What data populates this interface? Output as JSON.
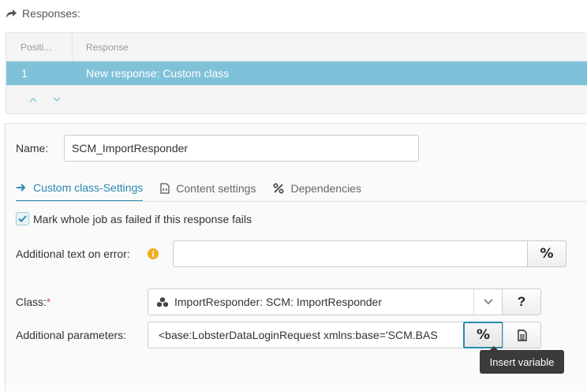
{
  "header": {
    "title": "Responses:",
    "icon": "share-arrow-icon"
  },
  "table": {
    "columns": [
      "Positi...",
      "Response"
    ],
    "rows": [
      {
        "position": "1",
        "response": "New response: Custom class",
        "selected": true
      }
    ],
    "controls": [
      "move-up-icon",
      "move-down-icon"
    ]
  },
  "form": {
    "name_label": "Name:",
    "name_value": "SCM_ImportResponder",
    "tabs": [
      {
        "prefix": "Custom class",
        "suffix": "-Settings",
        "icon": "arrow-right-icon",
        "active": true
      },
      {
        "label": "Content settings",
        "icon": "code-file-icon",
        "active": false
      },
      {
        "label": "Dependencies",
        "icon": "percent-icon",
        "active": false
      }
    ],
    "mark_failed_label": "Mark whole job as failed if this response fails",
    "mark_failed_checked": true,
    "additional_text_label": "Additional text on error:",
    "additional_text_value": "",
    "class_label": "Class:",
    "class_required_mark": "*",
    "class_value": "ImportResponder: SCM: ImportResponder",
    "help_button": "?",
    "params_label": "Additional parameters:",
    "params_value": "<base:LobsterDataLoginRequest xmlns:base='SCM.BAS",
    "variable_button": "%",
    "tooltip": "Insert variable"
  },
  "colors": {
    "accent": "#2a8ab0",
    "selection": "#7fc1d9",
    "info": "#f0ad1e",
    "required": "#d9534f"
  }
}
